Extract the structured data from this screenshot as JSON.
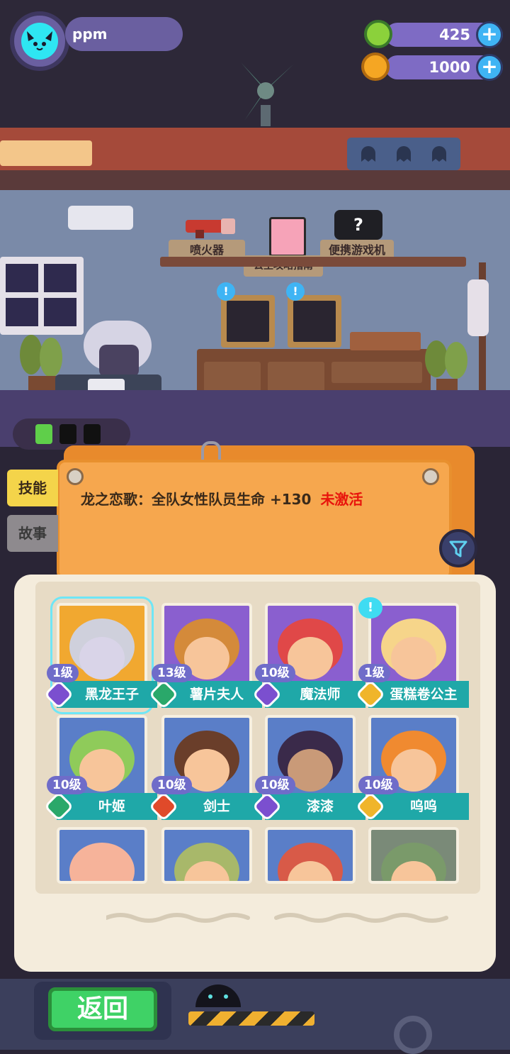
{
  "player": {
    "name": "ppm"
  },
  "currencies": [
    {
      "id": "green",
      "value": "425",
      "color": "#8bd13b"
    },
    {
      "id": "gold",
      "value": "1000",
      "color": "#f5a623"
    }
  ],
  "room": {
    "items": [
      {
        "label": "喷火器"
      },
      {
        "label": "公主攻略指南"
      },
      {
        "label": "便携游戏机"
      }
    ]
  },
  "notice": {
    "skill_text": "龙之恋歌：全队女性队员生命 +130",
    "status_text": "未激活",
    "status_color": "#e8140c"
  },
  "tabs": [
    {
      "label": "技能",
      "active": true
    },
    {
      "label": "故事",
      "active": false
    }
  ],
  "characters": [
    {
      "name": "黑龙王子",
      "level": "1级",
      "rarity_color": "#7b4fcf",
      "bg": "#f1a830",
      "skin": "#d9d4e8",
      "hair": "#cfd0dc",
      "selected": true
    },
    {
      "name": "薯片夫人",
      "level": "13级",
      "rarity_color": "#2aa86a",
      "bg": "#8a5fcf",
      "skin": "#f7c59a",
      "hair": "#d48a3a"
    },
    {
      "name": "魔法师",
      "level": "10级",
      "rarity_color": "#7b4fcf",
      "bg": "#8a5fcf",
      "skin": "#f7c59a",
      "hair": "#e04848"
    },
    {
      "name": "蛋糕卷公主",
      "level": "1级",
      "rarity_color": "#f0b52a",
      "bg": "#8a5fcf",
      "skin": "#f7c59a",
      "hair": "#f6d58a",
      "notify": true
    },
    {
      "name": "叶姬",
      "level": "10级",
      "rarity_color": "#2aa86a",
      "bg": "#5a7ec8",
      "skin": "#f7c59a",
      "hair": "#8fcb5a"
    },
    {
      "name": "剑士",
      "level": "10级",
      "rarity_color": "#e04a2a",
      "bg": "#5a7ec8",
      "skin": "#f7c59a",
      "hair": "#6a3e2a"
    },
    {
      "name": "漆漆",
      "level": "10级",
      "rarity_color": "#7b4fcf",
      "bg": "#5a7ec8",
      "skin": "#c99a78",
      "hair": "#3a2a4a"
    },
    {
      "name": "呜呜",
      "level": "10级",
      "rarity_color": "#f0b52a",
      "bg": "#5a7ec8",
      "skin": "#f7c59a",
      "hair": "#f08a30"
    },
    {
      "name": "",
      "level": "",
      "bg": "#5a7ec8",
      "skin": "#f6b39a",
      "hair": "#f6b39a"
    },
    {
      "name": "",
      "level": "",
      "bg": "#5a7ec8",
      "skin": "#f7c59a",
      "hair": "#a8b86a"
    },
    {
      "name": "",
      "level": "",
      "bg": "#5a7ec8",
      "skin": "#f7c59a",
      "hair": "#d85a48"
    },
    {
      "name": "",
      "level": "",
      "bg": "#7a8a78",
      "skin": "#f7c59a",
      "hair": "#7a9a6a"
    }
  ],
  "buttons": {
    "back": "返回"
  }
}
